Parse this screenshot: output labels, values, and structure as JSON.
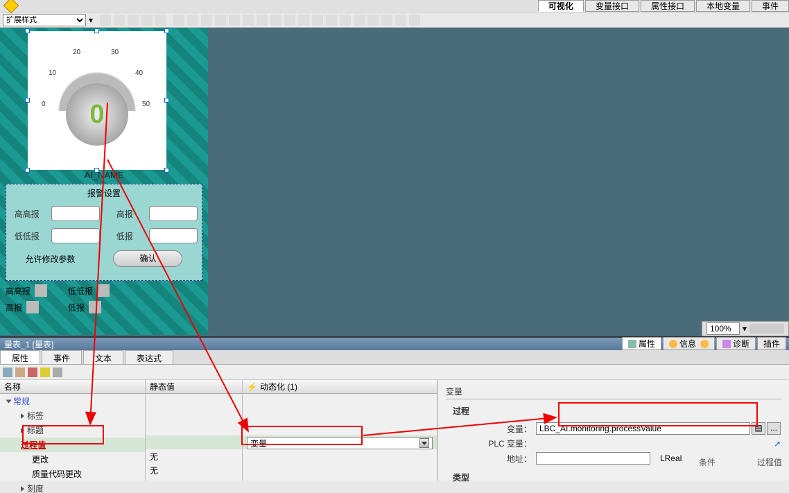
{
  "top_tabs": [
    "可视化",
    "变量接口",
    "属性接口",
    "本地变量",
    "事件"
  ],
  "top_tab_active": "可视化",
  "style_select": "扩展样式",
  "gauge": {
    "value": "0",
    "ticks": [
      "0",
      "10",
      "20",
      "30",
      "40",
      "50"
    ],
    "name": "AI_NAME"
  },
  "alarm": {
    "title": "报警设置",
    "hihi": "高高报",
    "hi": "高报",
    "lolo": "低低报",
    "lo": "低报",
    "allow_edit": "允许修改参数",
    "confirm": "确认"
  },
  "status": {
    "hihi": "高高报",
    "hi": "高报",
    "lolo": "低低报",
    "lo": "低报"
  },
  "zoom": "100%",
  "object_title": "量表_1 [量表]",
  "ptabs": {
    "prop": "属性",
    "info": "信息",
    "diag": "诊断",
    "plugin": "插件"
  },
  "sub_tabs": [
    "属性",
    "事件",
    "文本",
    "表达式"
  ],
  "columns": {
    "name": "名称",
    "static": "静态值",
    "dyn": "动态化 (1)"
  },
  "tree": {
    "root": "常规",
    "tag_grp": "标签",
    "title_grp": "标题",
    "process": "过程值",
    "change": "更改",
    "quality": "质量代码更改",
    "scale": "刻度",
    "none": "无",
    "var": "变量"
  },
  "right": {
    "var_grp": "变量",
    "process_grp": "过程",
    "type_grp": "类型",
    "variable_lbl": "变量：",
    "plc_lbl": "PLC 变量：",
    "addr_lbl": "地址：",
    "cond_lbl": "条件",
    "procval_lbl": "过程值",
    "variable_val": "LBC_AI.monitoring.processValue",
    "datatype": "LReal",
    "btn_list": "▤",
    "btn_more": "..."
  }
}
